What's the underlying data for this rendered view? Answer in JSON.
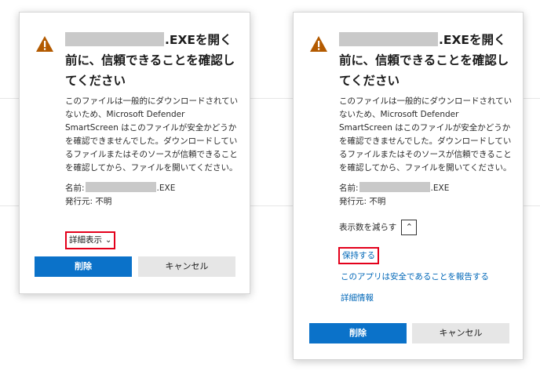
{
  "dialogs": [
    {
      "title_rest": ".EXEを開く前に、信頼できることを確認してください",
      "description": "このファイルは一般的にダウンロードされていないため、Microsoft Defender SmartScreen はこのファイルが安全かどうかを確認できませんでした。ダウンロードしているファイルまたはそのソースが信頼できることを確認してから、ファイルを開いてください。",
      "name_label": "名前:",
      "name_ext": ".EXE",
      "publisher": "発行元: 不明",
      "show_more": "詳細表示",
      "delete": "削除",
      "cancel": "キャンセル"
    },
    {
      "title_rest": ".EXEを開く前に、信頼できることを確認してください",
      "description": "このファイルは一般的にダウンロードされていないため、Microsoft Defender SmartScreen はこのファイルが安全かどうかを確認できませんでした。ダウンロードしているファイルまたはそのソースが信頼できることを確認してから、ファイルを開いてください。",
      "name_label": "名前:",
      "name_ext": ".EXE",
      "publisher": "発行元: 不明",
      "show_fewer": "表示数を減らす",
      "keep": "保持する",
      "report_safe": "このアプリは安全であることを報告する",
      "more_info": "詳細情報",
      "delete": "削除",
      "cancel": "キャンセル"
    }
  ],
  "colors": {
    "primary_button": "#0b72c9",
    "link": "#0067b8",
    "highlight_box": "#e3001b",
    "warning_icon": "#b35a00"
  },
  "icons": {
    "warning": "warning-triangle-icon",
    "chevron_down": "chevron-down-icon",
    "chevron_up": "chevron-up-icon"
  }
}
